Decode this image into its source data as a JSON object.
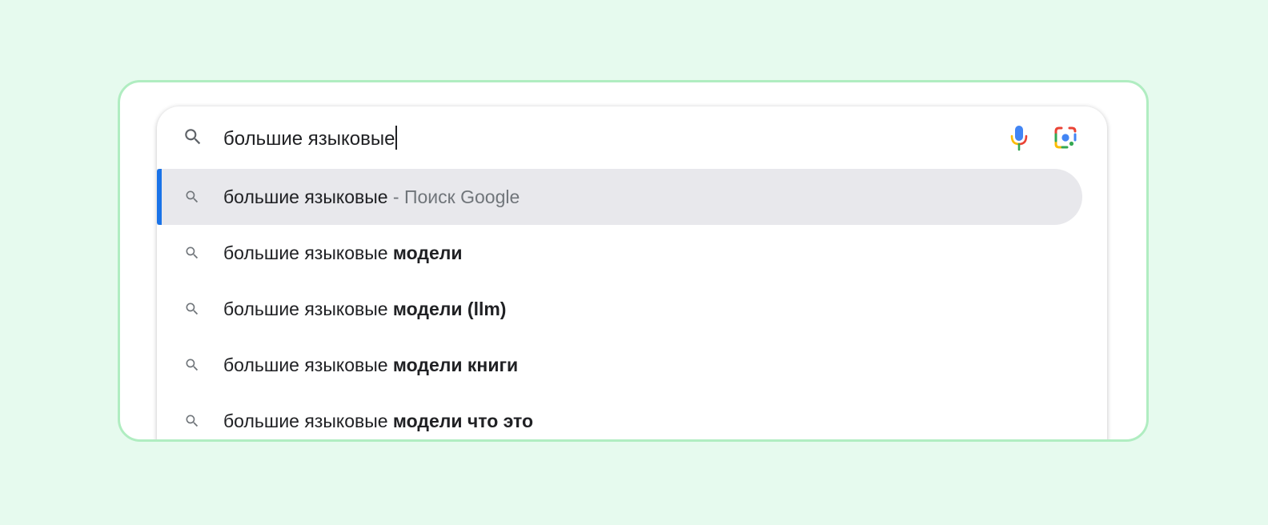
{
  "search": {
    "query": "большие языковые",
    "icons": {
      "search": "search-icon",
      "voice": "microphone-icon",
      "lens": "google-lens-icon"
    }
  },
  "suggestions": [
    {
      "prefix": "большие языковые",
      "completion": "",
      "secondary": " - Поиск Google",
      "active": true
    },
    {
      "prefix": "большие языковые ",
      "completion": "модели",
      "secondary": "",
      "active": false
    },
    {
      "prefix": "большие языковые ",
      "completion": "модели (llm)",
      "secondary": "",
      "active": false
    },
    {
      "prefix": "большие языковые ",
      "completion": "модели книги",
      "secondary": "",
      "active": false
    },
    {
      "prefix": "большие языковые ",
      "completion": "модели что это",
      "secondary": "",
      "active": false
    }
  ],
  "colors": {
    "page_background": "#e6faee",
    "frame_border": "#b0edc1",
    "active_row": "#e8e8ec",
    "accent": "#1a73e8",
    "text": "#202124",
    "secondary_text": "#70757a",
    "google_blue": "#4285f4",
    "google_red": "#ea4335",
    "google_yellow": "#fbbc04",
    "google_green": "#34a853"
  }
}
